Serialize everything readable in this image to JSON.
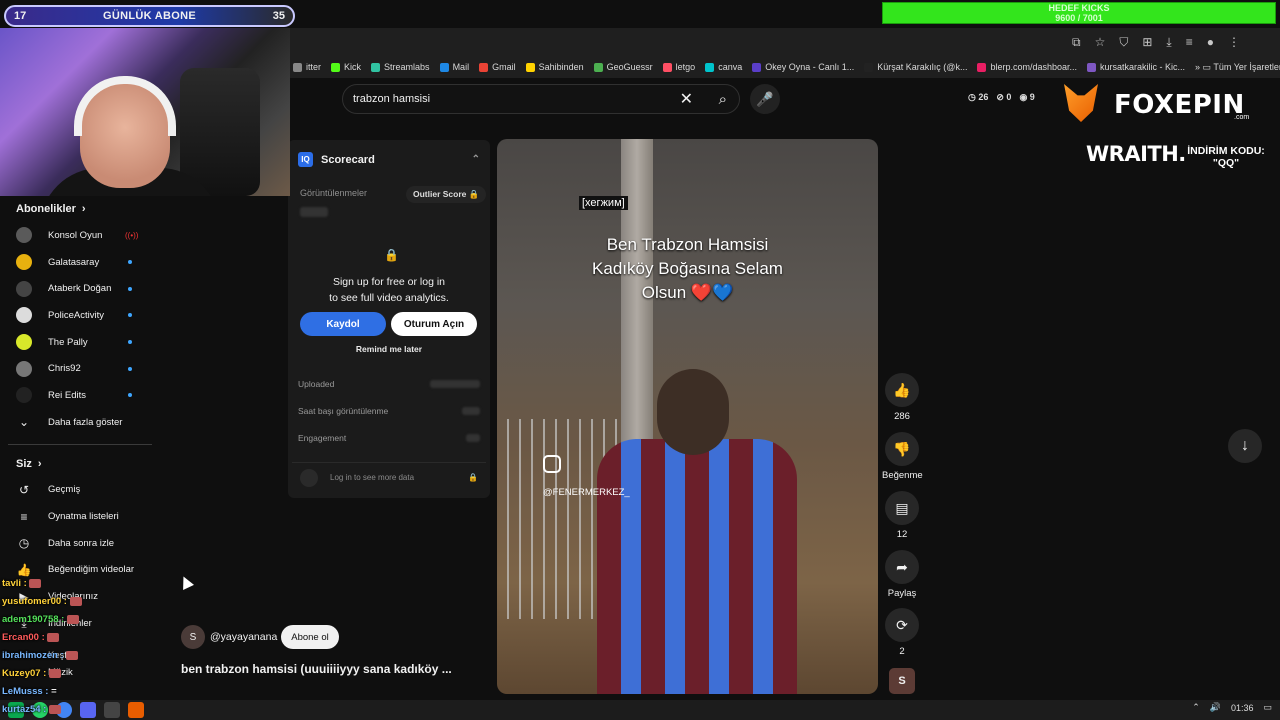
{
  "overlay": {
    "subs_goal": {
      "left": "17",
      "label": "GÜNLÜK ABONE",
      "right": "35"
    },
    "kicks_goal": {
      "title": "HEDEF KICKS",
      "progress": "9600 / 7001"
    }
  },
  "bookmarks": [
    "itter",
    "Kick",
    "Streamlabs",
    "Mail",
    "Gmail",
    "Sahibinden",
    "GeoGuessr",
    "letgo",
    "canva",
    "Okey Oyna - Canlı 1...",
    "Kürşat Karakılıç (@k...",
    "blerp.com/dashboar...",
    "kursatkarakilic - Kic..."
  ],
  "bookmarks_folder": "Tüm Yer İşaretleri",
  "sidebar": {
    "subscriptions_header": "Abonelikler",
    "channels": [
      {
        "name": "Konsol Oyun",
        "live": true,
        "color": "#5a5a5a"
      },
      {
        "name": "Galatasaray",
        "live": false,
        "color": "#e8b10f"
      },
      {
        "name": "Ataberk Doğan",
        "live": false,
        "color": "#444"
      },
      {
        "name": "PoliceActivity",
        "live": false,
        "color": "#dcdcdc"
      },
      {
        "name": "The Pally",
        "live": false,
        "color": "#d8e82a"
      },
      {
        "name": "Chris92",
        "live": false,
        "color": "#777"
      },
      {
        "name": "Rei Edits",
        "live": false,
        "color": "#222"
      }
    ],
    "show_more": "Daha fazla göster",
    "you_header": "Siz",
    "you_items": [
      "Geçmiş",
      "Oynatma listeleri",
      "Daha sonra izle",
      "Beğendiğim videolar",
      "Videolarınız",
      "İndirilenler"
    ],
    "explore": "Keşfet",
    "music": "Müzik"
  },
  "chat": [
    {
      "user": "tavli",
      "color": "#ffd23a",
      "text": ""
    },
    {
      "user": "yusufomer00",
      "color": "#ffd23a",
      "text": ""
    },
    {
      "user": "adem190758",
      "color": "#54e05a",
      "text": ""
    },
    {
      "user": "Ercan00",
      "color": "#ff5b5b",
      "text": ""
    },
    {
      "user": "ibrahimozen",
      "color": "#79b8ff",
      "text": ""
    },
    {
      "user": "Kuzey07",
      "color": "#ffd23a",
      "text": ""
    },
    {
      "user": "LeMusss",
      "color": "#79b8ff",
      "text": "="
    },
    {
      "user": "kurtaz54",
      "color": "#79b8ff",
      "text": ""
    }
  ],
  "search": {
    "value": "trabzon hamsisi"
  },
  "stats": {
    "a": "26",
    "b": "0",
    "c": "9"
  },
  "scorecard": {
    "title": "Scorecard",
    "views_label": "Görüntülenmeler",
    "outlier": "Outlier Score",
    "signup_line1": "Sign up for free or log in",
    "signup_line2": "to see full video analytics.",
    "register": "Kaydol",
    "login": "Oturum Açın",
    "remind": "Remind me later",
    "uploaded": "Uploaded",
    "hourly_views": "Saat başı görüntülenme",
    "engagement": "Engagement",
    "more": "Log in to see more data"
  },
  "video": {
    "tag": "[хегжим]",
    "caption_line1": "Ben Trabzon Hamsisi",
    "caption_line2": "Kadıköy Boğasına Selam",
    "caption_line3": "Olsun ❤️💙",
    "watermark": "@FENERMERKEZ_"
  },
  "actions": {
    "likes": "286",
    "dislike": "Beğenme",
    "comments": "12",
    "share": "Paylaş",
    "remix": "2",
    "avatar": "S"
  },
  "channel": {
    "avatar": "S",
    "name": "@yayayanana",
    "subscribe": "Abone ol"
  },
  "short_title": "ben trabzon hamsisi (uuuiiiiyyy sana kadıköy ...",
  "sponsor": {
    "brand": "FOXEPIN",
    "domain": ".com",
    "wraith": "WRAITH.",
    "promo_line1": "İNDİRİM KODU:",
    "promo_line2": "\"QQ\""
  },
  "taskbar": {
    "time": "01:36"
  }
}
